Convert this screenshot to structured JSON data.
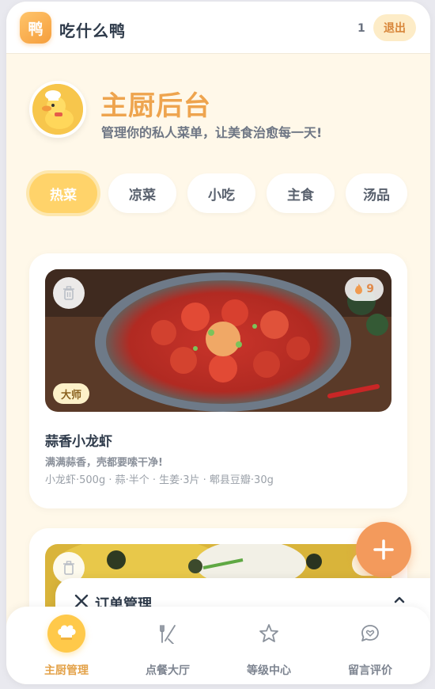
{
  "header": {
    "logo_char": "鸭",
    "app_title": "吃什么鸭",
    "user_count": "1",
    "logout_label": "退出"
  },
  "hero": {
    "avatar_icon": "duck-chef-icon",
    "title": "主厨后台",
    "subtitle": "管理你的私人菜单，让美食治愈每一天!"
  },
  "tabs": [
    {
      "label": "热菜",
      "active": true
    },
    {
      "label": "凉菜",
      "active": false
    },
    {
      "label": "小吃",
      "active": false
    },
    {
      "label": "主食",
      "active": false
    },
    {
      "label": "汤品",
      "active": false
    }
  ],
  "dishes": [
    {
      "name": "蒜香小龙虾",
      "description": "满满蒜香，壳都要嗦干净!",
      "ingredients": "小龙虾·500g · 蒜·半个 · 生姜·3片 · 郫县豆瓣·30g",
      "heat": "9",
      "level": "大师"
    },
    {
      "name": "",
      "description": "",
      "ingredients": "",
      "heat": "",
      "level": ""
    }
  ],
  "order_panel": {
    "title": "订单管理"
  },
  "bottom_nav": [
    {
      "label": "主厨管理",
      "icon": "chef-hat-icon",
      "active": true
    },
    {
      "label": "点餐大厅",
      "icon": "utensils-icon",
      "active": false
    },
    {
      "label": "等级中心",
      "icon": "star-icon",
      "active": false
    },
    {
      "label": "留言评价",
      "icon": "message-heart-icon",
      "active": false
    }
  ],
  "colors": {
    "accent": "#f39a5c",
    "brand_yellow": "#ffd36a",
    "title_orange": "#eea44e",
    "background": "#fff8e9"
  }
}
